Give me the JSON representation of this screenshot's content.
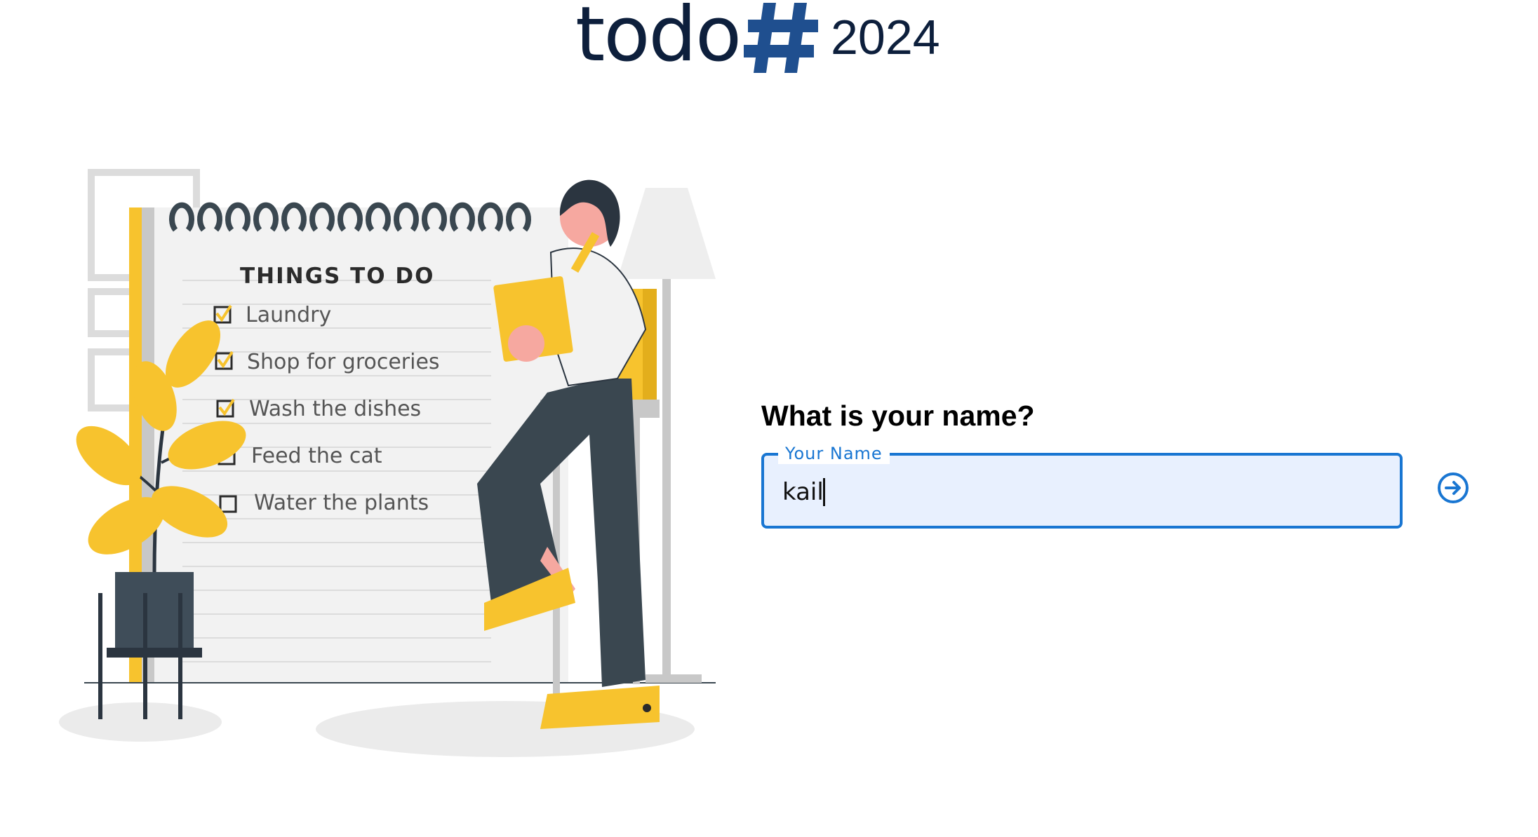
{
  "logo": {
    "word": "todo",
    "hash_symbol": "#",
    "year": "2024",
    "color": "#0d1f3c",
    "hash_color": "#1f4f8f"
  },
  "illustration": {
    "heading": "THINGS TO DO",
    "items": [
      {
        "label": "Laundry",
        "checked": true
      },
      {
        "label": "Shop for groceries",
        "checked": true
      },
      {
        "label": "Wash the dishes",
        "checked": true
      },
      {
        "label": "Feed the cat",
        "checked": false
      },
      {
        "label": "Water the plants",
        "checked": false
      }
    ],
    "accent_color": "#f7c32e"
  },
  "form": {
    "question": "What is your name?",
    "field_label": "Your Name",
    "field_value": "kail",
    "submit_icon": "arrow-right-circle-icon",
    "accent_color": "#1976d2"
  }
}
